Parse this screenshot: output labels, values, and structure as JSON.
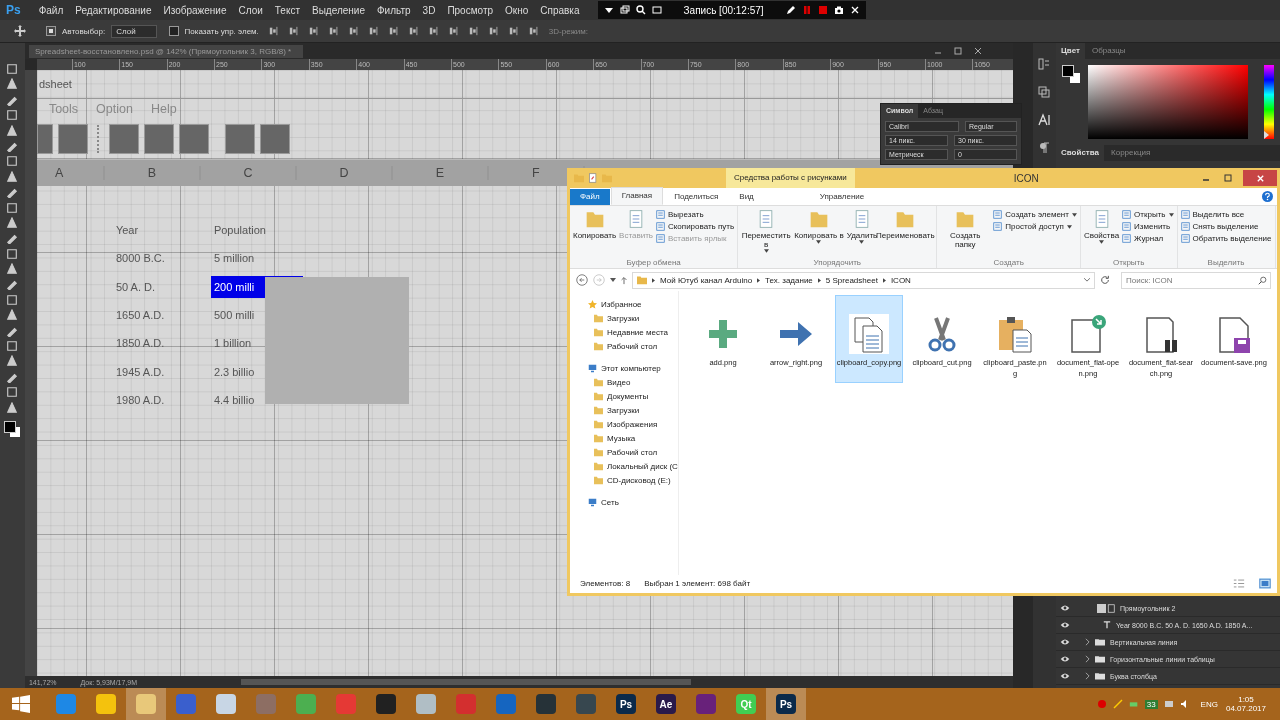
{
  "app_logo": "Ps",
  "menu_bar": [
    "Файл",
    "Редактирование",
    "Изображение",
    "Слои",
    "Текст",
    "Выделение",
    "Фильтр",
    "3D",
    "Просмотр",
    "Окно",
    "Справка"
  ],
  "recorder": {
    "title": "Запись [00:12:57]"
  },
  "options_bar": {
    "auto_select_label": "Автовыбор:",
    "auto_select_checked": true,
    "auto_select_value": "Слой",
    "show_controls_label": "Показать упр. элем.",
    "show_controls_checked": false,
    "mode_3d": "3D-режим:"
  },
  "document": {
    "tab_title": "Spreadsheet-восстановлено.psd @ 142% (Прямоугольник 3, RGB/8) *",
    "ruler_ticks": [
      "100",
      "150",
      "200",
      "250",
      "300",
      "350",
      "400",
      "450",
      "500",
      "550",
      "600",
      "650",
      "700",
      "750",
      "800",
      "850",
      "900",
      "950",
      "1000",
      "1050"
    ],
    "zoom": "141,72%",
    "doc_size": "Док: 5,93M/17,9M"
  },
  "mockup": {
    "title": "dsheet",
    "menu": [
      "Tools",
      "Option",
      "Help"
    ],
    "columns": [
      "A",
      "B",
      "C",
      "D",
      "E",
      "F"
    ],
    "header": [
      "Year",
      "Population"
    ],
    "rows": [
      {
        "year": "8000 B.C.",
        "population": "5 million",
        "selected": false
      },
      {
        "year": "50 A. D.",
        "population": "200 milli",
        "selected": true
      },
      {
        "year": "1650 A.D.",
        "population": "500 milli",
        "selected": false
      },
      {
        "year": "1850 A.D.",
        "population": "1 billion",
        "selected": false
      },
      {
        "year": "1945 A.D.",
        "population": "2.3 billio",
        "selected": false
      },
      {
        "year": "1980 A.D.",
        "population": "4.4 billio",
        "selected": false
      }
    ]
  },
  "character_panel": {
    "tabs": [
      {
        "label": "Символ",
        "selected": true
      },
      {
        "label": "Абзац",
        "selected": false
      }
    ],
    "font": "Calibri",
    "style": "Regular",
    "size": "14 пикс.",
    "leading": "30 пикс.",
    "kerning": "Метрическ",
    "tracking": "0"
  },
  "color_panel": {
    "tabs": [
      {
        "label": "Цвет",
        "selected": true
      },
      {
        "label": "Образцы",
        "selected": false
      }
    ],
    "hue_slider": {
      "level": 0
    }
  },
  "properties_panel": {
    "tabs": [
      {
        "label": "Свойства",
        "selected": true
      },
      {
        "label": "Коррекция",
        "selected": false
      }
    ]
  },
  "layers": [
    {
      "name": "Прямоугольник 2",
      "kind": "shape"
    },
    {
      "name": "Year 8000 B.C. 50 A. D. 1650 A.D. 1850 A...",
      "kind": "text"
    },
    {
      "name": "Вертикальная линия",
      "kind": "group"
    },
    {
      "name": "Горизонтальные линии таблицы",
      "kind": "group"
    },
    {
      "name": "Буква столбца",
      "kind": "group"
    }
  ],
  "explorer": {
    "title": "ICON",
    "context_label": "Средства работы с рисунками",
    "tabs": [
      {
        "label": "Файл",
        "kind": "file",
        "selected": false
      },
      {
        "label": "Главная",
        "kind": "tab",
        "selected": true
      },
      {
        "label": "Поделиться",
        "kind": "tab",
        "selected": false
      },
      {
        "label": "Вид",
        "kind": "tab",
        "selected": false
      },
      {
        "label": "Управление",
        "kind": "context",
        "selected": false
      }
    ],
    "groups": [
      {
        "label": "Буфер обмена",
        "items": [
          {
            "kind": "big",
            "label": "Копировать",
            "disabled": false,
            "dropdown": false
          },
          {
            "kind": "big",
            "label": "Вставить",
            "disabled": true,
            "dropdown": false
          },
          {
            "kind": "small",
            "label": "Вырезать",
            "disabled": false,
            "dropdown": false
          },
          {
            "kind": "small",
            "label": "Скопировать путь",
            "disabled": false,
            "dropdown": false
          },
          {
            "kind": "small",
            "label": "Вставить ярлык",
            "disabled": true,
            "dropdown": false
          }
        ]
      },
      {
        "label": "Упорядочить",
        "items": [
          {
            "kind": "big",
            "label": "Переместить в",
            "disabled": false,
            "dropdown": true
          },
          {
            "kind": "big",
            "label": "Копировать в",
            "disabled": false,
            "dropdown": true
          },
          {
            "kind": "big",
            "label": "Удалить",
            "disabled": false,
            "dropdown": true
          },
          {
            "kind": "big",
            "label": "Переименовать",
            "disabled": false,
            "dropdown": false
          }
        ]
      },
      {
        "label": "Создать",
        "items": [
          {
            "kind": "big",
            "label": "Создать папку",
            "disabled": false,
            "dropdown": false
          },
          {
            "kind": "small",
            "label": "Создать элемент",
            "disabled": false,
            "dropdown": true
          },
          {
            "kind": "small",
            "label": "Простой доступ",
            "disabled": false,
            "dropdown": true
          }
        ]
      },
      {
        "label": "Открыть",
        "items": [
          {
            "kind": "big",
            "label": "Свойства",
            "disabled": false,
            "dropdown": true
          },
          {
            "kind": "small",
            "label": "Открыть",
            "disabled": false,
            "dropdown": true
          },
          {
            "kind": "small",
            "label": "Изменить",
            "disabled": false,
            "dropdown": false
          },
          {
            "kind": "small",
            "label": "Журнал",
            "disabled": false,
            "dropdown": false
          }
        ]
      },
      {
        "label": "Выделить",
        "items": [
          {
            "kind": "small",
            "label": "Выделить все",
            "disabled": false,
            "dropdown": false
          },
          {
            "kind": "small",
            "label": "Снять выделение",
            "disabled": false,
            "dropdown": false
          },
          {
            "kind": "small",
            "label": "Обратить выделение",
            "disabled": false,
            "dropdown": false
          }
        ]
      }
    ],
    "path": [
      "Мой Ютуб канал Arduino",
      "Тех. задание",
      "5 Spreadsheet",
      "ICON"
    ],
    "search": {
      "placeholder": "Поиск: ICON"
    },
    "tree": [
      {
        "label": "Избранное",
        "children": [
          {
            "label": "Загрузки"
          },
          {
            "label": "Недавние места"
          },
          {
            "label": "Рабочий стол"
          }
        ]
      },
      {
        "label": "Этот компьютер",
        "children": [
          {
            "label": "Видео"
          },
          {
            "label": "Документы"
          },
          {
            "label": "Загрузки"
          },
          {
            "label": "Изображения"
          },
          {
            "label": "Музыка"
          },
          {
            "label": "Рабочий стол"
          },
          {
            "label": "Локальный диск (C"
          },
          {
            "label": "CD-дисковод (E:)"
          }
        ]
      },
      {
        "label": "Сеть"
      }
    ],
    "files": [
      {
        "name": "add.png",
        "selected": false
      },
      {
        "name": "arrow_right.png",
        "selected": false
      },
      {
        "name": "clipboard_copy.png",
        "selected": true
      },
      {
        "name": "clipboard_cut.png",
        "selected": false
      },
      {
        "name": "clipboard_paste.png",
        "selected": false
      },
      {
        "name": "document_flat-open.png",
        "selected": false
      },
      {
        "name": "document_flat-search.png",
        "selected": false
      },
      {
        "name": "document-save.png",
        "selected": false
      }
    ],
    "status": [
      "Элементов: 8",
      "Выбран 1 элемент: 698 байт"
    ]
  },
  "taskbar": {
    "apps": [
      {
        "color": "#1e88e5"
      },
      {
        "color": "#f4c20d"
      },
      {
        "color": "#e8c87a"
      },
      {
        "color": "#3a5fcd"
      },
      {
        "color": "#c8d6e5"
      },
      {
        "color": "#8d6e63"
      },
      {
        "color": "#4caf50"
      },
      {
        "color": "#e53935"
      },
      {
        "color": "#212121"
      },
      {
        "color": "#b0bec5"
      },
      {
        "color": "#d32f2f"
      },
      {
        "color": "#1565c0"
      },
      {
        "color": "#263238"
      },
      {
        "color": "#37474f"
      },
      {
        "color": "#0b2a4a",
        "label": "Ps"
      },
      {
        "color": "#2a1a4a",
        "label": "Ae"
      },
      {
        "color": "#68217a"
      },
      {
        "color": "#41cd52",
        "label": "Qt"
      },
      {
        "color": "#0b2a4a",
        "label": "Ps"
      }
    ],
    "tray_badge": "33",
    "language": "ENG",
    "time": "1:05",
    "date": "04.07.2017"
  }
}
